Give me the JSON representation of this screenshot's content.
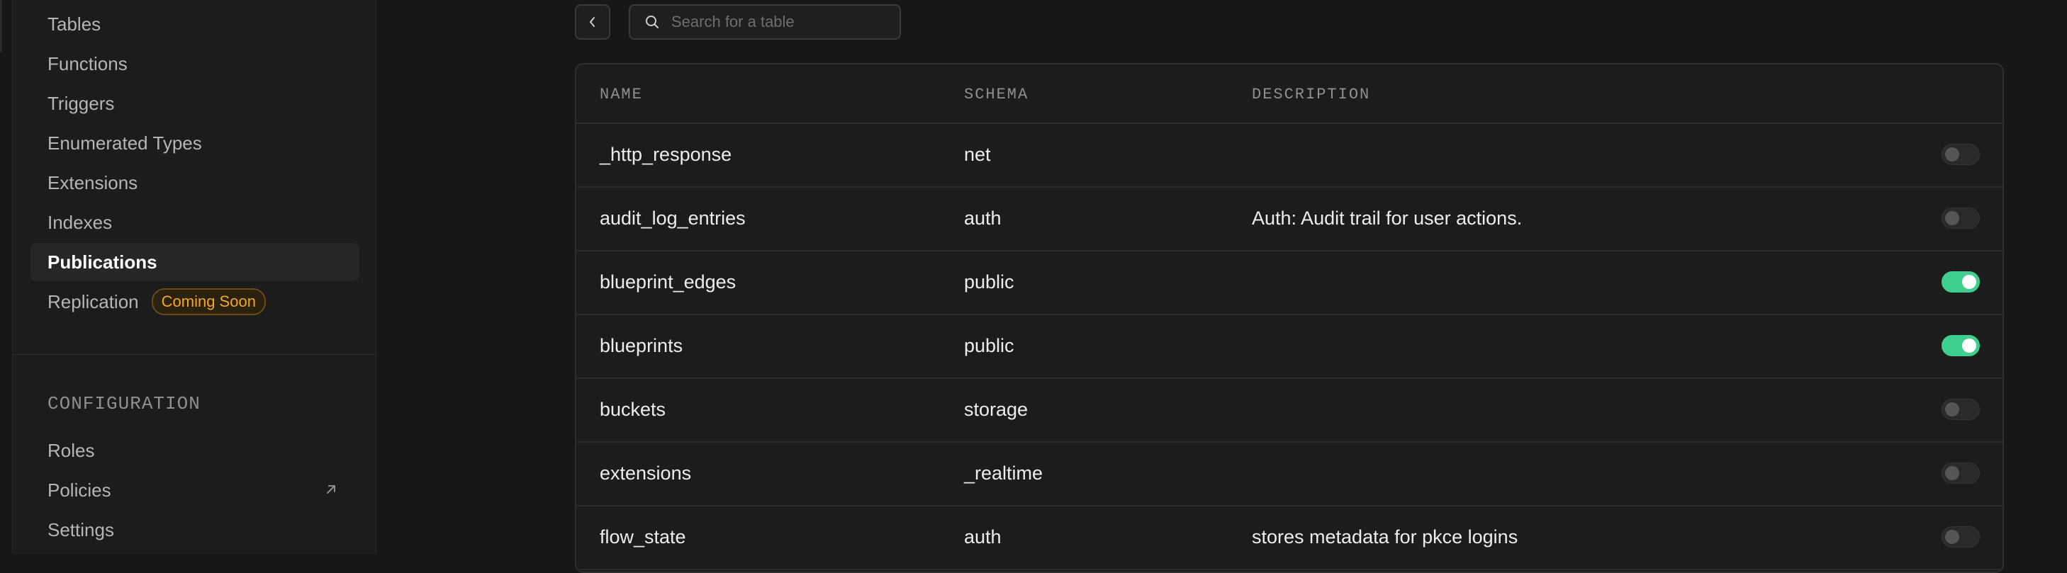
{
  "sidebar": {
    "items": [
      {
        "label": "Tables"
      },
      {
        "label": "Functions"
      },
      {
        "label": "Triggers"
      },
      {
        "label": "Enumerated Types"
      },
      {
        "label": "Extensions"
      },
      {
        "label": "Indexes"
      },
      {
        "label": "Publications",
        "active": true
      },
      {
        "label": "Replication",
        "badge": "Coming Soon"
      }
    ],
    "config_heading": "CONFIGURATION",
    "config_items": [
      {
        "label": "Roles"
      },
      {
        "label": "Policies",
        "icon": "external-link-icon"
      },
      {
        "label": "Settings"
      }
    ]
  },
  "toolbar": {
    "search_placeholder": "Search for a table"
  },
  "table": {
    "columns": [
      "NAME",
      "SCHEMA",
      "DESCRIPTION"
    ],
    "rows": [
      {
        "name": "_http_response",
        "schema": "net",
        "description": "",
        "enabled": false
      },
      {
        "name": "audit_log_entries",
        "schema": "auth",
        "description": "Auth: Audit trail for user actions.",
        "enabled": false
      },
      {
        "name": "blueprint_edges",
        "schema": "public",
        "description": "",
        "enabled": true
      },
      {
        "name": "blueprints",
        "schema": "public",
        "description": "",
        "enabled": true
      },
      {
        "name": "buckets",
        "schema": "storage",
        "description": "",
        "enabled": false
      },
      {
        "name": "extensions",
        "schema": "_realtime",
        "description": "",
        "enabled": false
      },
      {
        "name": "flow_state",
        "schema": "auth",
        "description": "stores metadata for pkce logins",
        "enabled": false
      }
    ]
  },
  "colors": {
    "accent_green": "#3ecf8e",
    "badge_orange": "#f5a623"
  }
}
